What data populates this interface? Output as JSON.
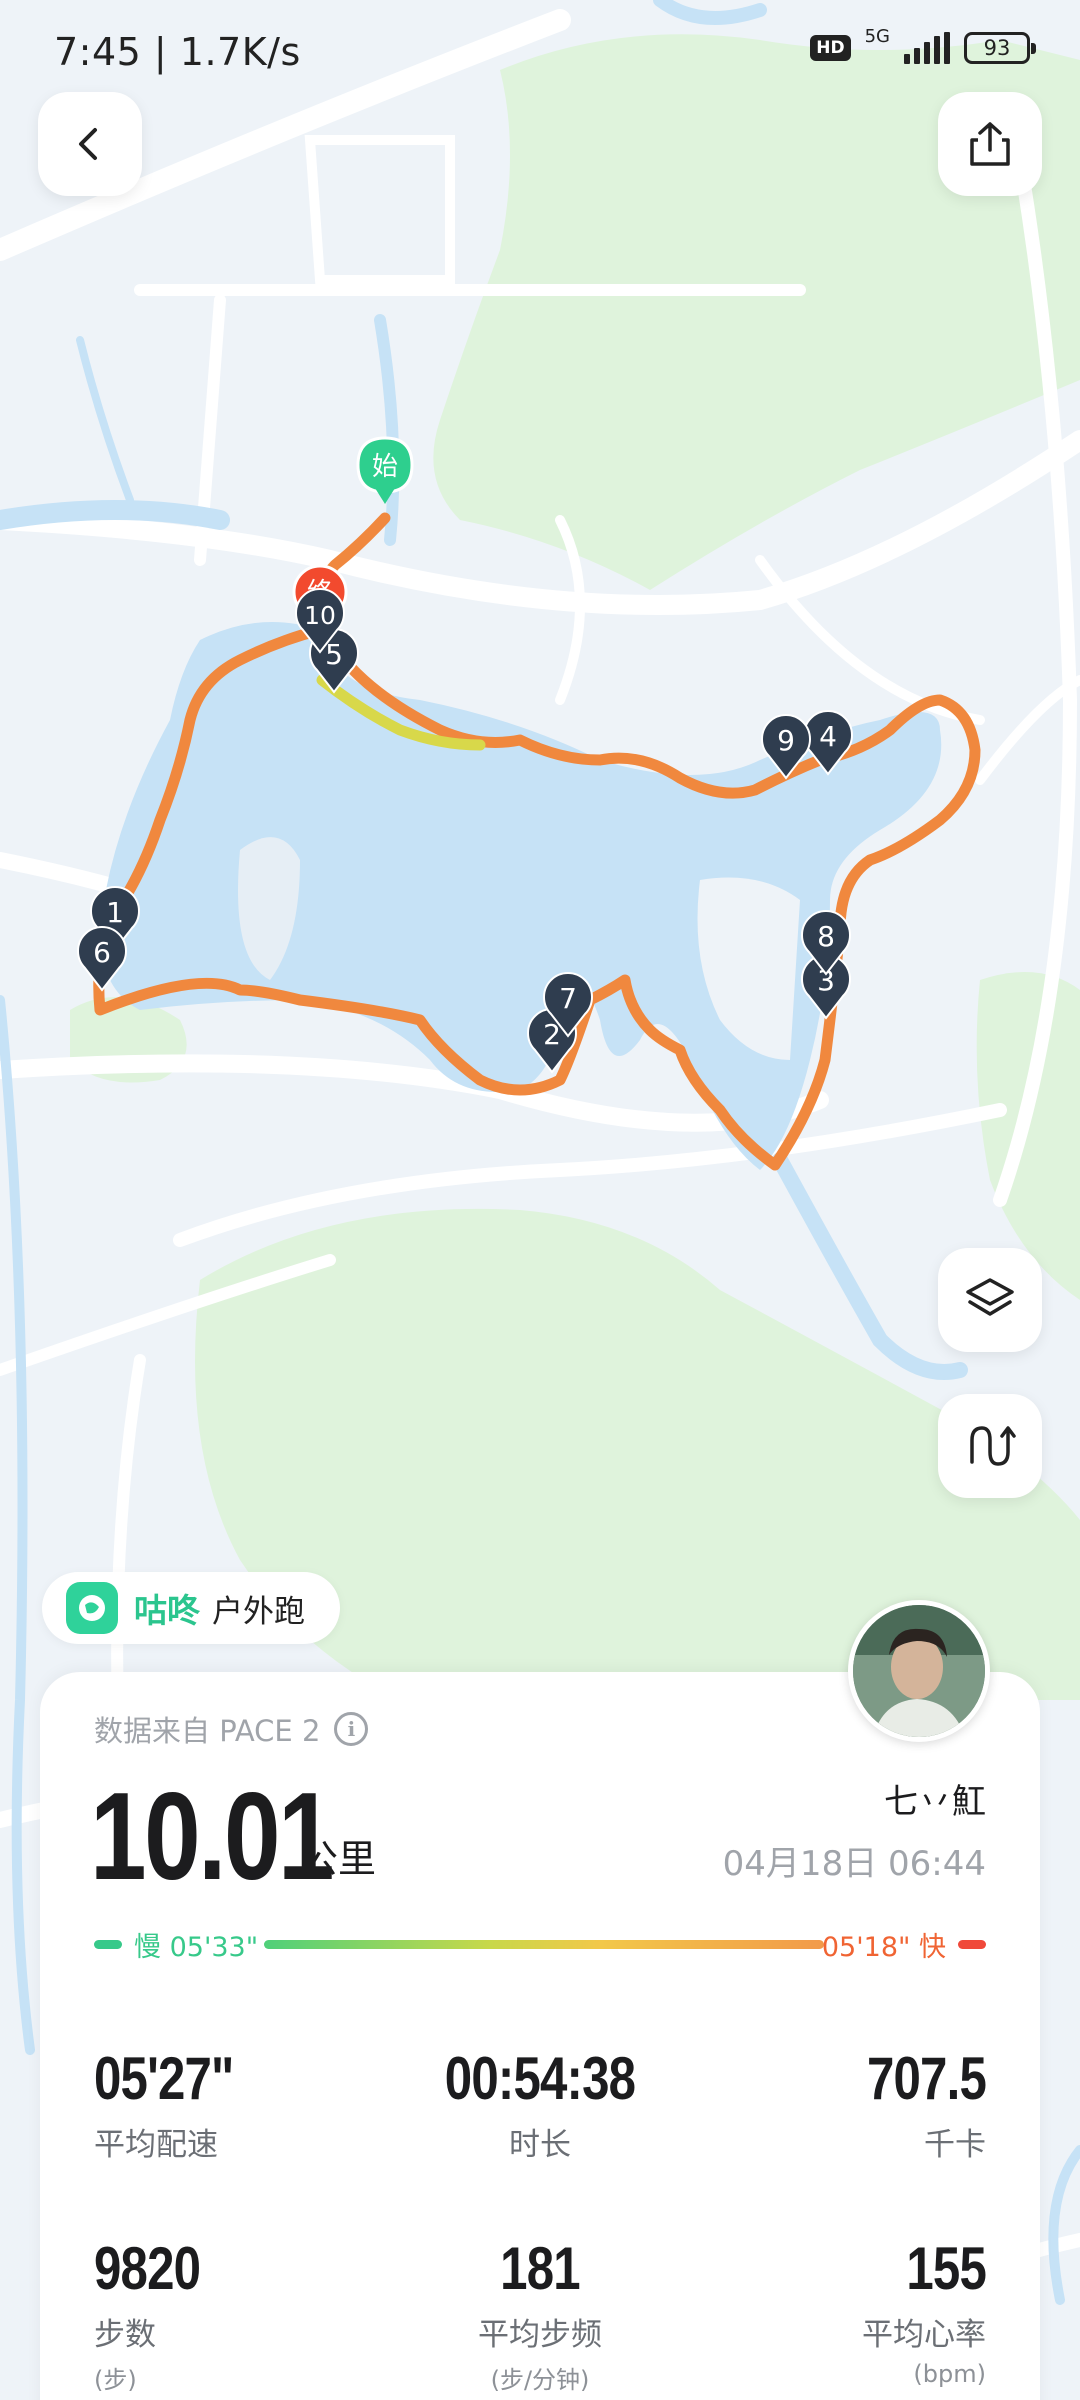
{
  "status_bar": {
    "time_speed": "7:45 | 1.7K/s",
    "hd": "HD",
    "network": "5G",
    "battery": "93"
  },
  "map": {
    "start_label": "始",
    "end_label": "终",
    "km_markers": [
      "1",
      "2",
      "3",
      "4",
      "5",
      "6",
      "7",
      "8",
      "9",
      "10"
    ],
    "colors": {
      "route": "#f0883e",
      "water": "#c6e2f6",
      "green": "#dff3dc",
      "road": "#ffffff",
      "marker": "#2f3d4f",
      "start": "#2ecf8e",
      "end": "#f24a2e"
    }
  },
  "brand": {
    "name": "咕咚",
    "activity": "户外跑"
  },
  "summary": {
    "source": "数据来自 PACE 2",
    "distance": "10.01",
    "distance_unit": "公里",
    "username": "七丷魟",
    "datetime": "04月18日 06:44"
  },
  "pace_scale": {
    "slow": "慢 05'33\"",
    "fast": "05'18\" 快"
  },
  "stats": [
    {
      "value": "05'27\"",
      "label": "平均配速",
      "unit": ""
    },
    {
      "value": "00:54:38",
      "label": "时长",
      "unit": ""
    },
    {
      "value": "707.5",
      "label": "千卡",
      "unit": ""
    },
    {
      "value": "9820",
      "label": "步数",
      "unit": "(步)"
    },
    {
      "value": "181",
      "label": "平均步频",
      "unit": "(步/分钟)"
    },
    {
      "value": "155",
      "label": "平均心率",
      "unit": "(bpm)"
    }
  ]
}
